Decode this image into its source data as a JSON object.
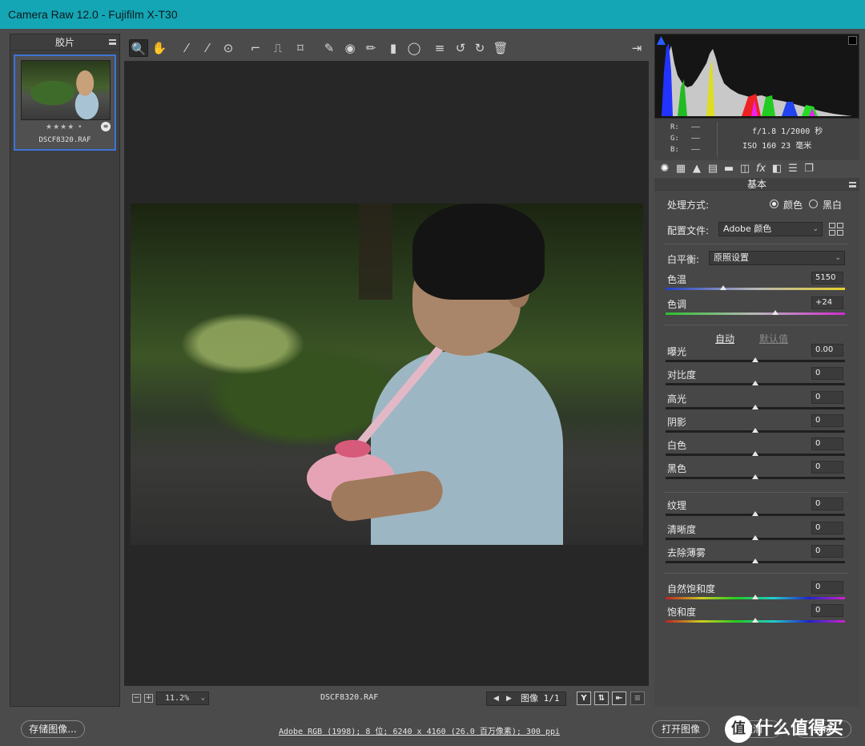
{
  "window": {
    "title": "Camera Raw 12.0 -  Fujifilm X-T30"
  },
  "filmstrip": {
    "title": "胶片",
    "thumb": {
      "rating": "★★★★ •",
      "filename": "DSCF8320.RAF"
    }
  },
  "toolbar": {
    "tools": [
      "zoom-icon",
      "hand-icon",
      "white-balance-icon",
      "color-sampler-icon",
      "targeted-adjustment-icon",
      "crop-icon",
      "straighten-icon",
      "transform-icon",
      "spot-removal-icon",
      "red-eye-icon",
      "adjustment-brush-icon",
      "graduated-filter-icon",
      "radial-filter-icon",
      "preferences-icon",
      "rotate-left-icon",
      "rotate-right-icon",
      "trash-icon"
    ],
    "glyphs": [
      "🔍",
      "✋",
      "⁄",
      "⁄",
      "⊙",
      "⌐",
      "⎍",
      "⌑",
      "✎",
      "◉",
      "✏",
      "▮",
      "◯",
      "≡",
      "↺",
      "↻",
      "🗑"
    ]
  },
  "statusbar": {
    "zoom_out": "−",
    "zoom_in": "+",
    "zoom": "11.2%",
    "filename": "DSCF8320.RAF",
    "image_count": "图像 1/1",
    "prev": "◀",
    "next": "▶"
  },
  "info": {
    "r_label": "R:",
    "g_label": "G:",
    "b_label": "B:",
    "r_value": "——",
    "g_value": "——",
    "b_value": "——",
    "exif_line1": "f/1.8  1/2000 秒",
    "exif_line2": "ISO 160  23 毫米"
  },
  "panel_tabs": [
    "basic-icon",
    "tone-curve-icon",
    "detail-icon",
    "hsl-icon",
    "split-toning-icon",
    "lens-icon",
    "fx-icon",
    "calibration-icon",
    "presets-icon",
    "snapshots-icon"
  ],
  "basic": {
    "title": "基本",
    "treatment_label": "处理方式:",
    "treatment_color": "颜色",
    "treatment_bw": "黑白",
    "profile_label": "配置文件:",
    "profile_value": "Adobe 颜色",
    "wb_label": "白平衡:",
    "wb_value": "原照设置",
    "auto": "自动",
    "default": "默认值",
    "sliders": [
      {
        "label": "色温",
        "value": "5150",
        "position": 0.32
      },
      {
        "label": "色调",
        "value": "+24",
        "position": 0.61
      },
      {
        "label": "曝光",
        "value": "0.00",
        "position": 0.5
      },
      {
        "label": "对比度",
        "value": "0",
        "position": 0.5
      },
      {
        "label": "高光",
        "value": "0",
        "position": 0.5
      },
      {
        "label": "阴影",
        "value": "0",
        "position": 0.5
      },
      {
        "label": "白色",
        "value": "0",
        "position": 0.5
      },
      {
        "label": "黑色",
        "value": "0",
        "position": 0.5
      },
      {
        "label": "纹理",
        "value": "0",
        "position": 0.5
      },
      {
        "label": "清晰度",
        "value": "0",
        "position": 0.5
      },
      {
        "label": "去除薄雾",
        "value": "0",
        "position": 0.5
      },
      {
        "label": "自然饱和度",
        "value": "0",
        "position": 0.5
      },
      {
        "label": "饱和度",
        "value": "0",
        "position": 0.5
      }
    ]
  },
  "bottom": {
    "save_label": "存储图像...",
    "workflow_info": "Adobe RGB (1998); 8 位; 6240 x 4160 (26.0 百万像素); 300 ppi",
    "open_label": "打开图像",
    "cancel_label": "取消",
    "done_label": "完成",
    "watermark": "什么值得买"
  }
}
